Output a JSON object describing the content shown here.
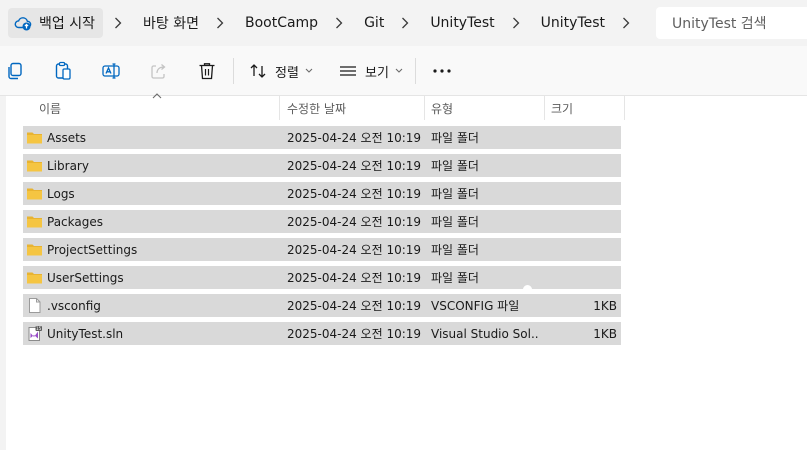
{
  "breadcrumb": [
    "백업 시작",
    "바탕 화면",
    "BootCamp",
    "Git",
    "UnityTest",
    "UnityTest"
  ],
  "search": {
    "placeholder": "UnityTest 검색"
  },
  "toolbar": {
    "sort_label": "정렬",
    "view_label": "보기"
  },
  "columns": {
    "name": "이름",
    "modified": "수정한 날짜",
    "type": "유형",
    "size": "크기"
  },
  "files": [
    {
      "name": "Assets",
      "modified": "2025-04-24 오전 10:19",
      "type": "파일 폴더",
      "size": "",
      "icon": "folder-icon"
    },
    {
      "name": "Library",
      "modified": "2025-04-24 오전 10:19",
      "type": "파일 폴더",
      "size": "",
      "icon": "folder-icon"
    },
    {
      "name": "Logs",
      "modified": "2025-04-24 오전 10:19",
      "type": "파일 폴더",
      "size": "",
      "icon": "folder-icon"
    },
    {
      "name": "Packages",
      "modified": "2025-04-24 오전 10:19",
      "type": "파일 폴더",
      "size": "",
      "icon": "folder-icon"
    },
    {
      "name": "ProjectSettings",
      "modified": "2025-04-24 오전 10:19",
      "type": "파일 폴더",
      "size": "",
      "icon": "folder-icon"
    },
    {
      "name": "UserSettings",
      "modified": "2025-04-24 오전 10:19",
      "type": "파일 폴더",
      "size": "",
      "icon": "folder-icon"
    },
    {
      "name": ".vsconfig",
      "modified": "2025-04-24 오전 10:19",
      "type": "VSCONFIG 파일",
      "size": "1KB",
      "icon": "file-icon"
    },
    {
      "name": "UnityTest.sln",
      "modified": "2025-04-24 오전 10:19",
      "type": "Visual Studio Sol...",
      "size": "1KB",
      "icon": "visual-studio-solution-icon"
    }
  ],
  "colors": {
    "selected_row": "#d9d9d9",
    "folder": "#f5c542",
    "accent": "#0067c0"
  }
}
